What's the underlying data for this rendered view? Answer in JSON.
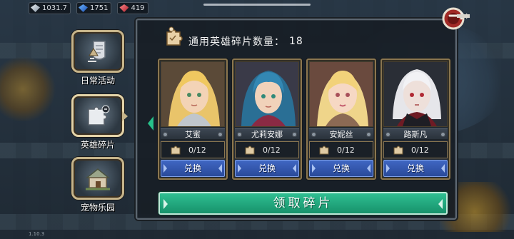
{
  "resources": [
    {
      "name": "silver",
      "value": "1031.7",
      "icon": "silver-gem-icon"
    },
    {
      "name": "blue",
      "value": "1751",
      "icon": "blue-gem-icon"
    },
    {
      "name": "red",
      "value": "419",
      "icon": "red-gem-icon"
    }
  ],
  "side_menu": [
    {
      "label": "日常活动",
      "icon": "daily-activity-icon",
      "active": false
    },
    {
      "label": "英雄碎片",
      "icon": "hero-fragment-icon",
      "active": true
    },
    {
      "label": "宠物乐园",
      "icon": "pet-park-icon",
      "active": false
    }
  ],
  "panel": {
    "title_label": "通用英雄碎片数量：",
    "title_count": "18"
  },
  "heroes": [
    {
      "name": "艾蜜",
      "progress": "0/12",
      "button": "兑换"
    },
    {
      "name": "尤莉安娜",
      "progress": "0/12",
      "button": "兑换"
    },
    {
      "name": "安妮丝",
      "progress": "0/12",
      "button": "兑换"
    },
    {
      "name": "路斯凡",
      "progress": "0/12",
      "button": "兑换"
    }
  ],
  "claim_button": "领取碎片",
  "version": "1.10.3",
  "colors": {
    "claim": "#22a87d",
    "exchange": "#3557b0",
    "frame_gold": "#8a7650"
  }
}
